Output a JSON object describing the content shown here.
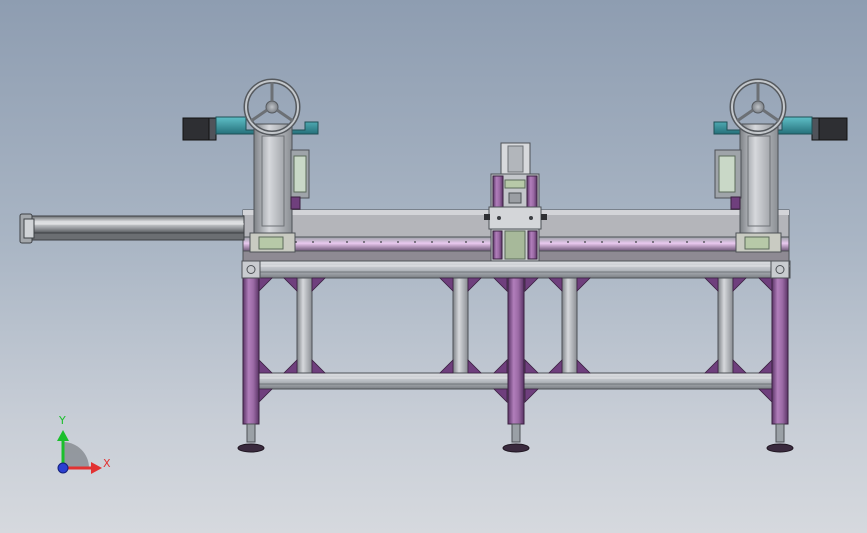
{
  "viewport": {
    "background_top": "#8e9db1",
    "background_bottom": "#d6d9de"
  },
  "model": {
    "colors": {
      "frame_purple": "#8c5a95",
      "frame_purple_light": "#b17ebb",
      "frame_purple_dark": "#5a3466",
      "steel": "#b8bcc2",
      "steel_light": "#d6d8dc",
      "steel_dark": "#6e7277",
      "bracket_teal": "#3c9aa3",
      "motor_black": "#2e2f33",
      "guide_green": "#b7c9a8",
      "foot_dark": "#3a2a3e",
      "rail_highlight": "#e9c9ef"
    }
  },
  "triad": {
    "y_label": "Y",
    "x_label": "X",
    "y_color": "#1bbf2c",
    "x_color": "#e23232",
    "z_color": "#2b3fd1"
  }
}
